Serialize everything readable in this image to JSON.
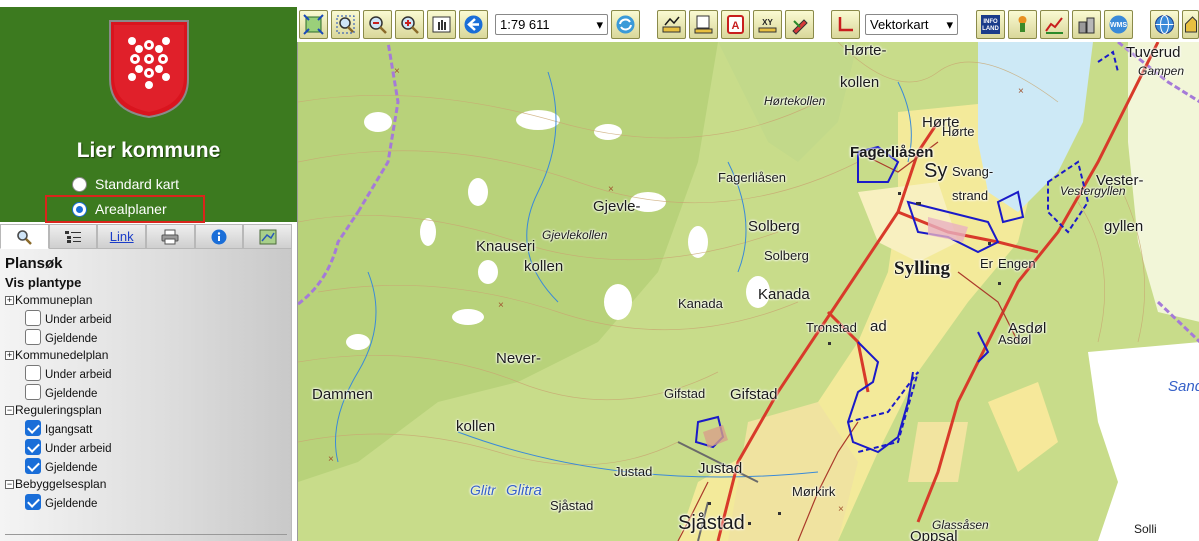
{
  "municipality": {
    "name": "Lier kommune"
  },
  "map_mode": {
    "options": [
      {
        "label": "Standard kart",
        "selected": false
      },
      {
        "label": "Arealplaner",
        "selected": true
      }
    ]
  },
  "tabs": [
    {
      "icon": "search-icon"
    },
    {
      "icon": "layers-icon"
    },
    {
      "label": "Link"
    },
    {
      "icon": "print-icon"
    },
    {
      "icon": "info-icon"
    },
    {
      "icon": "map-thumb-icon"
    }
  ],
  "panel": {
    "title": "Plansøk",
    "subtitle": "Vis plantype",
    "groups": [
      {
        "label": "Kommuneplan",
        "expanded": false,
        "options": [
          {
            "label": "Under arbeid",
            "checked": false
          },
          {
            "label": "Gjeldende",
            "checked": false
          }
        ]
      },
      {
        "label": "Kommunedelplan",
        "expanded": false,
        "options": [
          {
            "label": "Under arbeid",
            "checked": false
          },
          {
            "label": "Gjeldende",
            "checked": false
          }
        ]
      },
      {
        "label": "Reguleringsplan",
        "expanded": true,
        "options": [
          {
            "label": "Igangsatt",
            "checked": true
          },
          {
            "label": "Under arbeid",
            "checked": true
          },
          {
            "label": "Gjeldende",
            "checked": true
          }
        ]
      },
      {
        "label": "Bebyggelsesplan",
        "expanded": true,
        "options": [
          {
            "label": "Gjeldende",
            "checked": true
          }
        ]
      }
    ]
  },
  "toolbar": {
    "scale": "1:79 611",
    "layer": "Vektorkart",
    "buttons": [
      "zoom-extent-icon",
      "zoom-window-icon",
      "zoom-out-icon",
      "zoom-in-icon",
      "pan-icon",
      "back-icon",
      "refresh-icon",
      "measure-distance-icon",
      "measure-area-icon",
      "address-search-icon",
      "coordinate-icon",
      "draw-icon",
      "axis-icon",
      "infoland-icon",
      "property-icon",
      "profile-icon",
      "buildings-icon",
      "wms-icon",
      "globe-icon",
      "home-icon"
    ]
  },
  "map": {
    "labels": {
      "horte_kollen_a": "Hørte-",
      "horte_kollen_b": "kollen",
      "hortekollen_i": "Hørtekollen",
      "horte1": "Hørte",
      "horte2": "Hørte",
      "fagerliasen_big": "Fagerliåsen",
      "fagerliasen_small": "Fagerliåsen",
      "sy": "Sy",
      "svang_a": "Svang-",
      "svang_b": "strand",
      "tuverud": "Tuverud",
      "gampen": "Gampen",
      "vester_a": "Vester-",
      "vester_b": "gyllen",
      "vestergyllen_i": "Vestergyllen",
      "gjevle_a": "Gjevle-",
      "gjevle_b": "kollen",
      "gjevlekollen_i": "Gjevlekollen",
      "knauseri": "Knauseri",
      "solberg_big": "Solberg",
      "solberg_small": "Solberg",
      "sylling": "Sylling",
      "engen": "Engen",
      "er": "Er",
      "kanada_big": "Kanada",
      "kanada_small": "Kanada",
      "tronstad": "Tronstad",
      "ad": "ad",
      "asdol_big": "Asdøl",
      "asdol_small": "Asdøl",
      "never": "Never-",
      "dammen": "Dammen",
      "kollen_w": "kollen",
      "gifstad_small": "Gifstad",
      "gifstad_big": "Gifstad",
      "justad_small": "Justad",
      "justad_big": "Justad",
      "glitre": "Glitr",
      "glitra": "Glitra",
      "sjastad_small": "Sjåstad",
      "sjastad_big": "Sjåstad",
      "morkirk": "Mørkirk",
      "glassasen": "Glassåsen",
      "oppsal": "Oppsal",
      "sand": "Sand",
      "solli": "Solli"
    }
  }
}
